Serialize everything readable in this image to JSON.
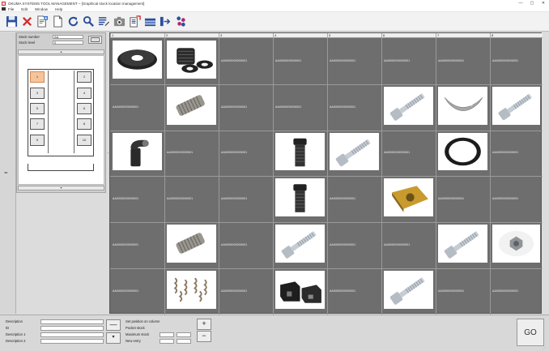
{
  "window": {
    "title": "OKUMA SYSTEMS TOOL MANAGEMENT – [Graphical stock location management]",
    "controls": [
      "—",
      "▢",
      "✕"
    ]
  },
  "menu": [
    "File",
    "Edit",
    "Window",
    "Help"
  ],
  "toolbar": {
    "buttons": [
      "save-icon",
      "delete-icon",
      "add-document-icon",
      "new-document-icon",
      "refresh-icon",
      "search-icon",
      "list-edit-icon",
      "camera-icon",
      "export-icon",
      "layers-icon",
      "transfer-icon",
      "users-icon"
    ]
  },
  "left_strip": {
    "collapse_label": "◂◂"
  },
  "stock": {
    "number_label": "Stock number",
    "number_value": "AA",
    "level_label": "Stock level",
    "level_value": "0",
    "scroll_up": "▴",
    "scroll_down": "▾",
    "slots": [
      "1",
      "2",
      "3",
      "4",
      "5",
      "6",
      "7",
      "8",
      "9",
      "10"
    ],
    "active_slot": "1"
  },
  "grid": {
    "columns": [
      "1",
      "2",
      "3",
      "4",
      "5",
      "6",
      "7",
      "8"
    ],
    "cell_code": "AA0000000000001",
    "row_arrow": "‹"
  },
  "bottom": {
    "labels": [
      "Description",
      "ID",
      "Description 1",
      "Description 2"
    ],
    "position_label": "Set position on column",
    "pocket_stock_label": "Pocket stock",
    "maximum_stock_label": "Maximum stock",
    "new_entry_label": "New entry",
    "minus_label": "—",
    "down_label": "▾",
    "plus_label": "+",
    "minus2_label": "−",
    "go_label": "GO",
    "grip_label": "⋰"
  }
}
